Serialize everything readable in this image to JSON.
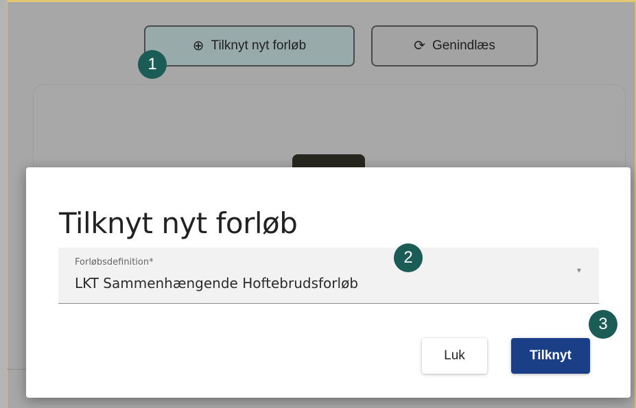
{
  "background": {
    "primary_button_label": "Tilknyt nyt forløb",
    "primary_button_icon": "plus-circle-icon",
    "reload_button_label": "Genindlæs",
    "reload_button_icon": "refresh-icon"
  },
  "dialog": {
    "title": "Tilknyt nyt forløb",
    "select": {
      "label": "Forløbsdefinition*",
      "value": "LKT Sammenhængende Hoftebrudsforløb",
      "arrow_icon": "dropdown-arrow-icon"
    },
    "close_label": "Luk",
    "submit_label": "Tilknyt"
  },
  "markers": [
    "1",
    "2",
    "3"
  ],
  "colors": {
    "marker": "#1c5c56",
    "submit_button": "#1b3f86",
    "frame_border": "#e4c870"
  }
}
